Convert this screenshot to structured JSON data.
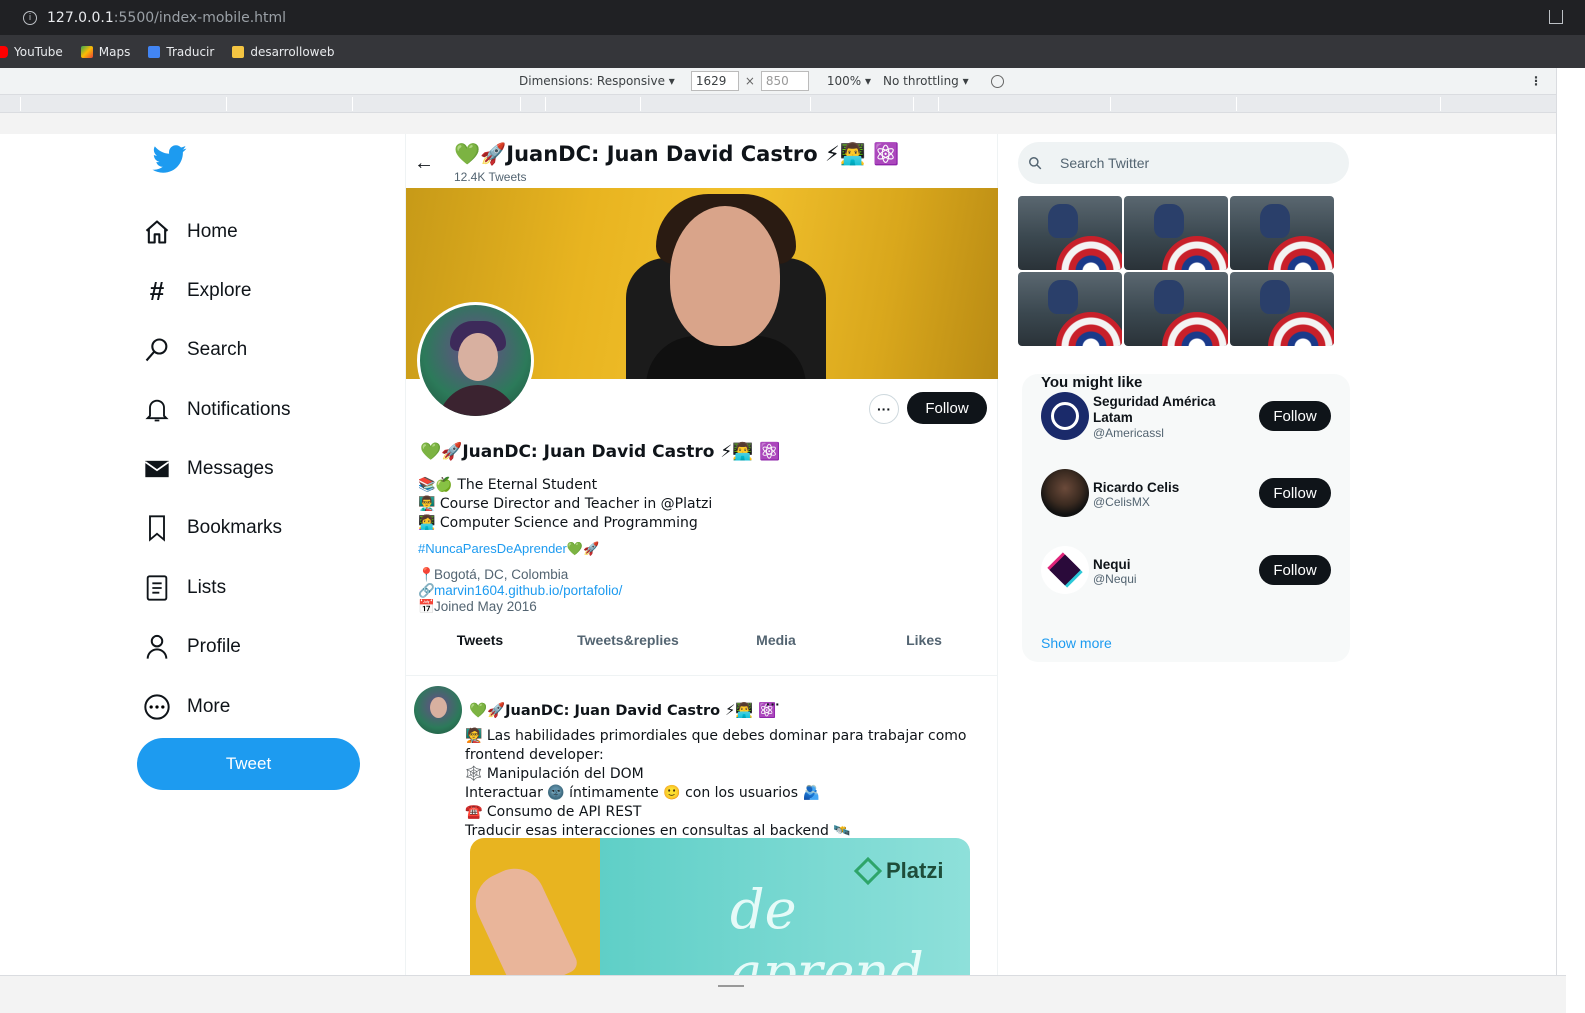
{
  "browser": {
    "url_host": "127.0.0.1",
    "url_rest": ":5500/index-mobile.html",
    "bookmarks": [
      "YouTube",
      "Maps",
      "Traducir",
      "desarrolloweb"
    ]
  },
  "devtools": {
    "dimensions_label": "Dimensions: Responsive ▾",
    "width": "1629",
    "height": "850",
    "zoom": "100% ▾",
    "throttling": "No throttling ▾"
  },
  "nav": {
    "items": [
      "Home",
      "Explore",
      "Search",
      "Notifications",
      "Messages",
      "Bookmarks",
      "Lists",
      "Profile",
      "More"
    ],
    "tweet_label": "Tweet"
  },
  "profile": {
    "header_name": "💚🚀JuanDC: Juan David Castro ⚡👨‍💻 ⚛️",
    "tweet_count": "12.4K Tweets",
    "name": "💚🚀JuanDC: Juan David Castro ⚡👨‍💻 ⚛️",
    "more_label": "···",
    "follow_label": "Follow",
    "bio": [
      "📚🍏 The Eternal Student",
      "👨‍🏫 Course Director and Teacher in @Platzi",
      "👩‍💻 Computer Science and Programming"
    ],
    "hashtag": "#NuncaParesDeAprender",
    "hashtag_emoji": "💚🚀",
    "location": "Bogotá, DC, Colombia",
    "website": "marvin1604.github.io/portafolio/",
    "joined": "Joined May 2016"
  },
  "tabs": [
    "Tweets",
    "Tweets&replies",
    "Media",
    "Likes"
  ],
  "tweet": {
    "name": "💚🚀JuanDC: Juan David Castro ⚡👨‍💻 ⚛️",
    "dots": "···",
    "lines": [
      "🧑‍🏫 Las habilidades primordiales que debes dominar para trabajar como frontend developer:",
      "🕸️ Manipulación del DOM",
      "Interactuar 🌚 íntimamente 🙂 con los usuarios 🫂",
      "☎️ Consumo de API REST",
      "Traducir esas interacciones en consultas al backend 🛰️"
    ],
    "media_brand": "Platzi",
    "media_script": "de aprend"
  },
  "right": {
    "search_placeholder": "Search Twitter",
    "you_might_like": "You might like",
    "suggestions": [
      {
        "name": "Seguridad América Latam",
        "handle": "@Americassl",
        "follow": "Follow"
      },
      {
        "name": "Ricardo Celis",
        "handle": "@CelisMX",
        "follow": "Follow"
      },
      {
        "name": "Nequi",
        "handle": "@Nequi",
        "follow": "Follow"
      }
    ],
    "show_more": "Show more"
  }
}
